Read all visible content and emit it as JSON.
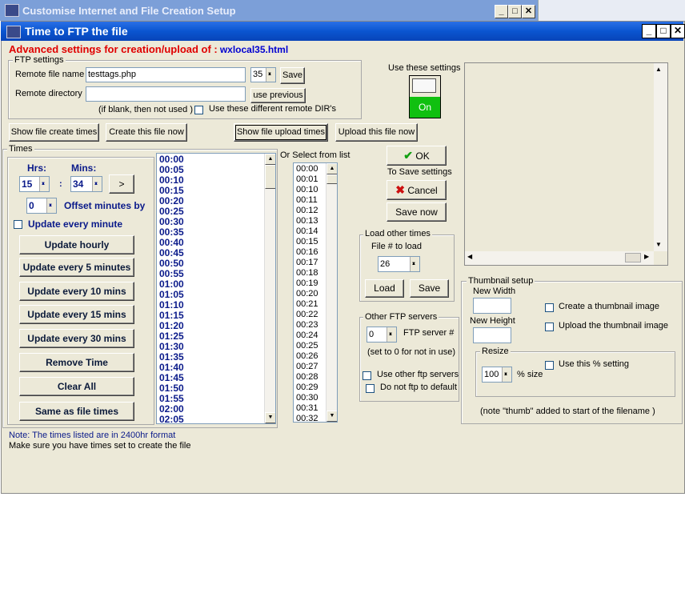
{
  "bg_window": {
    "title": "Customise Internet and File Creation Setup"
  },
  "window": {
    "title": "Time to FTP the file",
    "min": "_",
    "max": "□",
    "close": "✕"
  },
  "heading": {
    "prefix": "Advanced settings for creation/upload of :",
    "filename": "wxlocal35.html"
  },
  "ftp_settings": {
    "legend": "FTP settings",
    "remote_file_label": "Remote file name",
    "remote_file_value": "testtags.php",
    "num_value": "35",
    "save": "Save",
    "remote_dir_label": "Remote directory",
    "remote_dir_value": "",
    "use_previous": "use previous",
    "if_blank": "(if blank, then not used )",
    "diff_dirs": "Use these different remote DIR's"
  },
  "use_settings": {
    "label": "Use these settings",
    "state": "On"
  },
  "action_buttons": {
    "show_create": "Show file create times",
    "create_now": "Create this file now",
    "show_upload": "Show file upload times",
    "upload_now": "Upload this file now"
  },
  "times": {
    "legend": "Times",
    "hrs_label": "Hrs:",
    "mins_label": "Mins:",
    "hrs": "15",
    "colon": ":",
    "mins": "34",
    "arrow": ">",
    "offset": "0",
    "offset_label": "Offset minutes by",
    "every_minute": "Update every minute",
    "buttons": [
      "Update hourly",
      "Update every 5 minutes",
      "Update every 10 mins",
      "Update every 15 mins",
      "Update every 30 mins",
      "Remove Time",
      "Clear All",
      "Same as file times"
    ]
  },
  "times_list": [
    "00:00",
    "00:05",
    "00:10",
    "00:15",
    "00:20",
    "00:25",
    "00:30",
    "00:35",
    "00:40",
    "00:45",
    "00:50",
    "00:55",
    "01:00",
    "01:05",
    "01:10",
    "01:15",
    "01:20",
    "01:25",
    "01:30",
    "01:35",
    "01:40",
    "01:45",
    "01:50",
    "01:55",
    "02:00",
    "02:05"
  ],
  "select_list": {
    "label": "Or Select from list",
    "items": [
      "00:00",
      "00:01",
      "00:10",
      "00:11",
      "00:12",
      "00:13",
      "00:14",
      "00:15",
      "00:16",
      "00:17",
      "00:18",
      "00:19",
      "00:20",
      "00:21",
      "00:22",
      "00:23",
      "00:24",
      "00:25",
      "00:26",
      "00:27",
      "00:28",
      "00:29",
      "00:30",
      "00:31",
      "00:32"
    ]
  },
  "ok": "OK",
  "to_save": "To Save settings",
  "cancel": "Cancel",
  "save_now": "Save now",
  "load_other": {
    "legend": "Load other times",
    "file_label": "File # to load",
    "file_num": "26",
    "load": "Load",
    "save": "Save"
  },
  "other_ftp": {
    "legend": "Other FTP servers",
    "server_num": "0",
    "server_label": "FTP server #",
    "note": "(set to 0 for not in use)",
    "use_other": "Use other ftp servers",
    "no_default": "Do not ftp to default"
  },
  "thumbnail": {
    "legend": "Thumbnail setup",
    "new_width": "New Width",
    "new_height": "New Height",
    "create": "Create a thumbnail image",
    "upload": "Upload the thumbnail image",
    "resize_legend": "Resize",
    "pct": "100",
    "pct_label": "% size",
    "use_pct": "Use this % setting",
    "note": "(note \"thumb\" added to start of the filename )"
  },
  "notes": {
    "line1": "Note: The times listed are in 2400hr format",
    "line2": "Make sure you have times set to create the file"
  },
  "colors": {
    "title_blue": "#0a55d0",
    "heading_red": "#e00000",
    "on_green": "#10c010"
  }
}
